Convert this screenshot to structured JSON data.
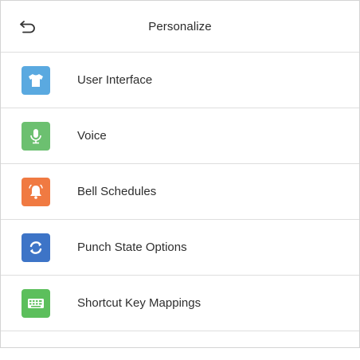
{
  "header": {
    "title": "Personalize",
    "back_icon": "back-arrow-icon"
  },
  "menu": {
    "items": [
      {
        "label": "User Interface",
        "icon": "shirt-icon",
        "color": "#5aa9e0"
      },
      {
        "label": "Voice",
        "icon": "microphone-icon",
        "color": "#6cc070"
      },
      {
        "label": "Bell Schedules",
        "icon": "bell-icon",
        "color": "#f07a42"
      },
      {
        "label": "Punch State Options",
        "icon": "refresh-icon",
        "color": "#3d74c7"
      },
      {
        "label": "Shortcut Key Mappings",
        "icon": "keyboard-icon",
        "color": "#5cbf5c"
      }
    ]
  }
}
